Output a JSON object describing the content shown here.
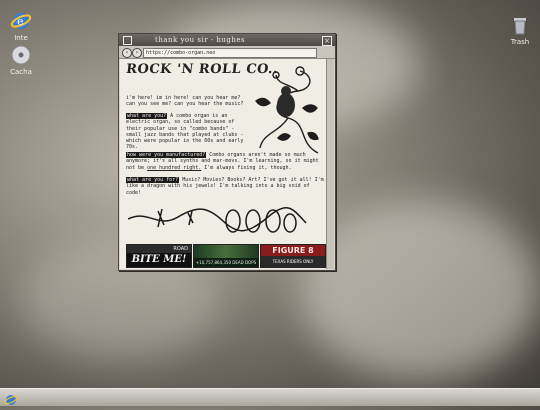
{
  "desktop": {
    "icons": [
      {
        "label": "Inte",
        "icon": "internet-explorer-icon"
      },
      {
        "label": "Cacha",
        "icon": "cd-icon"
      },
      {
        "label": "Trash",
        "icon": "trash-icon"
      }
    ]
  },
  "window": {
    "title": "thank you sir - hughes",
    "url": "https://combo-organ.neo"
  },
  "page": {
    "logo": "ROCK 'N ROLL CO..",
    "intro": "i'm here! im in here! can you hear me? can you see me? can you hear the music?",
    "q1_label": "what are you?",
    "q1_text": " A combo organ is an electric organ, so called because of their popular use in \"combo bands\" - small jazz bands that played at clubs - which were popular in the 60s and early 70s.",
    "q2_label": "how were you manufactured?",
    "q2_text": " Combo organs aren't made so much anymore; it's all synths and mar-movs. I'm learning, so it might not be",
    "q2_link": "one hundred right.",
    "q2_text_end": " I'm always fixing it, though.",
    "q3_label": "what are you for?",
    "q3_text": " Music? Movies? Books? Art? I've got it all! I'm like a dragon with his jewels! I'm talking into a big void of code!",
    "banners": [
      {
        "text": "BITE ME!",
        "sub": "ROAD"
      },
      {
        "text": "+10,757,864,350 DEAD DOPS",
        "sub": ""
      },
      {
        "text": "FIGURE 8",
        "sub": "TEXAS RIDERS ONLY"
      }
    ]
  }
}
